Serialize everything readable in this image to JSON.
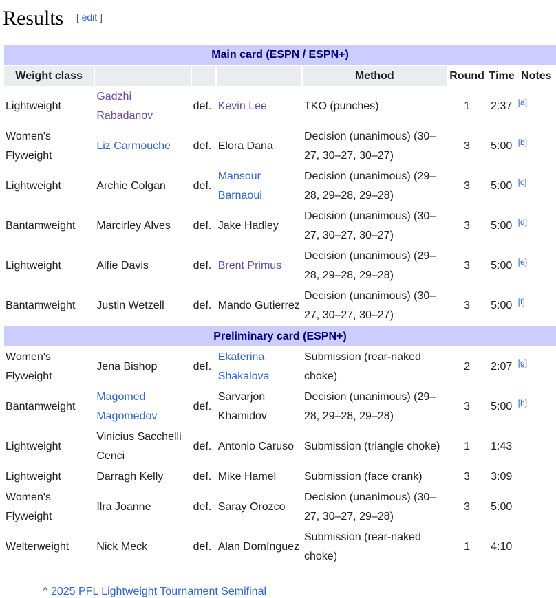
{
  "section": {
    "title": "Results",
    "edit_open": "[",
    "edit_label": "edit",
    "edit_close": "]"
  },
  "columns": {
    "weight_class": "Weight class",
    "method": "Method",
    "round": "Round",
    "time": "Time",
    "notes": "Notes"
  },
  "main_card": {
    "title": "Main card (ESPN / ESPN+)",
    "fights": [
      {
        "weight": "Lightweight",
        "winner": "Gadzhi Rabadanov",
        "winner_link": "visited",
        "def": "def.",
        "loser": "Kevin Lee",
        "loser_link": "visited",
        "method": "TKO (punches)",
        "round": "1",
        "time": "2:37",
        "note": "[a]"
      },
      {
        "weight": "Women's Flyweight",
        "winner": "Liz Carmouche",
        "winner_link": "link",
        "def": "def.",
        "loser": "Elora Dana",
        "loser_link": "",
        "method": "Decision (unanimous) (30–27, 30–27, 30–27)",
        "round": "3",
        "time": "5:00",
        "note": "[b]"
      },
      {
        "weight": "Lightweight",
        "winner": "Archie Colgan",
        "winner_link": "",
        "def": "def.",
        "loser": "Mansour Barnaoui",
        "loser_link": "link",
        "method": "Decision (unanimous) (29–28, 29–28, 29–28)",
        "round": "3",
        "time": "5:00",
        "note": "[c]"
      },
      {
        "weight": "Bantamweight",
        "winner": "Marcirley Alves",
        "winner_link": "",
        "def": "def.",
        "loser": "Jake Hadley",
        "loser_link": "",
        "method": "Decision (unanimous) (30–27, 30–27, 30–27)",
        "round": "3",
        "time": "5:00",
        "note": "[d]"
      },
      {
        "weight": "Lightweight",
        "winner": "Alfie Davis",
        "winner_link": "",
        "def": "def.",
        "loser": "Brent Primus",
        "loser_link": "visited",
        "method": "Decision (unanimous) (29–28, 29–28, 29–28)",
        "round": "3",
        "time": "5:00",
        "note": "[e]"
      },
      {
        "weight": "Bantamweight",
        "winner": "Justin Wetzell",
        "winner_link": "",
        "def": "def.",
        "loser": "Mando Gutierrez",
        "loser_link": "",
        "method": "Decision (unanimous) (30–27, 30–27, 30–27)",
        "round": "3",
        "time": "5:00",
        "note": "[f]"
      }
    ]
  },
  "prelim_card": {
    "title": "Preliminary card (ESPN+)",
    "fights": [
      {
        "weight": "Women's Flyweight",
        "winner": "Jena Bishop",
        "winner_link": "",
        "def": "def.",
        "loser": "Ekaterina Shakalova",
        "loser_link": "link",
        "method": "Submission (rear-naked choke)",
        "round": "2",
        "time": "2:07",
        "note": "[g]"
      },
      {
        "weight": "Bantamweight",
        "winner": "Magomed Magomedov",
        "winner_link": "link",
        "def": "def.",
        "loser": "Sarvarjon Khamidov",
        "loser_link": "",
        "method": "Decision (unanimous) (29–28, 29–28, 29–28)",
        "round": "3",
        "time": "5:00",
        "note": "[h]"
      },
      {
        "weight": "Lightweight",
        "winner": "Vinicius Sacchelli Cenci",
        "winner_link": "",
        "def": "def.",
        "loser": "Antonio Caruso",
        "loser_link": "",
        "method": "Submission (triangle choke)",
        "round": "1",
        "time": "1:43",
        "note": ""
      },
      {
        "weight": "Lightweight",
        "winner": "Darragh Kelly",
        "winner_link": "",
        "def": "def.",
        "loser": "Mike Hamel",
        "loser_link": "",
        "method": "Submission (face crank)",
        "round": "3",
        "time": "3:09",
        "note": "",
        "single": true
      },
      {
        "weight": "Women's Flyweight",
        "winner": "Ilra Joanne",
        "winner_link": "",
        "def": "def.",
        "loser": "Saray Orozco",
        "loser_link": "",
        "method": "Decision (unanimous) (30–27, 30–27, 29–28)",
        "round": "3",
        "time": "5:00",
        "note": ""
      },
      {
        "weight": "Welterweight",
        "winner": "Nick Meck",
        "winner_link": "",
        "def": "def.",
        "loser": "Alan Domínguez",
        "loser_link": "",
        "method": "Submission (rear-naked choke)",
        "round": "1",
        "time": "4:10",
        "note": ""
      }
    ]
  },
  "footer_line": "^ 2025 PFL Lightweight Tournament Semifinal"
}
